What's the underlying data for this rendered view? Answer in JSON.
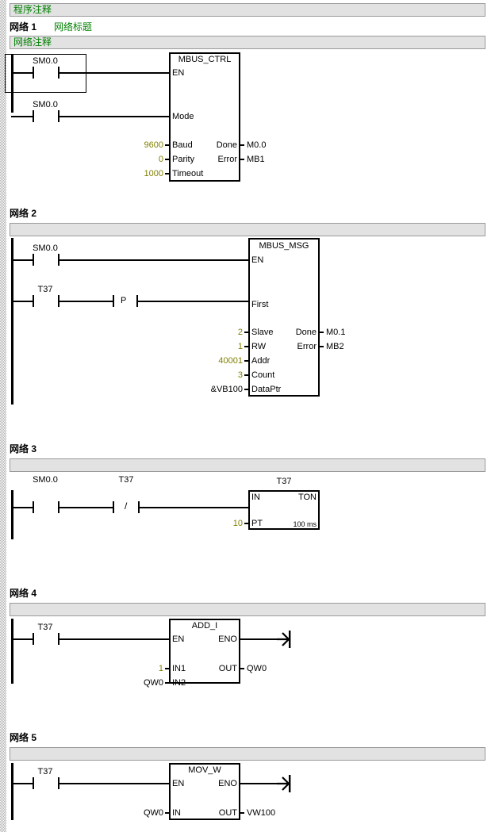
{
  "document": {
    "program_comment": "程序注释",
    "type": "ladder-logic-lad"
  },
  "networks": [
    {
      "label": "网络 1",
      "title": "网络标题",
      "comment": "网络注释",
      "rungs": [
        {
          "contact": "SM0.0",
          "selected": true
        },
        {
          "contact": "SM0.0",
          "selected": false
        }
      ],
      "block": {
        "name": "MBUS_CTRL",
        "inputs": [
          {
            "pin": "EN",
            "value": ""
          },
          {
            "pin": "Mode",
            "value": ""
          },
          {
            "pin": "Baud",
            "value": "9600",
            "const": true
          },
          {
            "pin": "Parity",
            "value": "0",
            "const": true
          },
          {
            "pin": "Timeout",
            "value": "1000",
            "const": true
          }
        ],
        "outputs": [
          {
            "pin": "Done",
            "value": "M0.0"
          },
          {
            "pin": "Error",
            "value": "MB1"
          }
        ]
      }
    },
    {
      "label": "网络 2",
      "title": "",
      "comment": "",
      "rungs": [
        {
          "contact": "SM0.0",
          "selected": false
        },
        {
          "contact": "T37",
          "edge": "P",
          "selected": false
        }
      ],
      "block": {
        "name": "MBUS_MSG",
        "inputs": [
          {
            "pin": "EN",
            "value": ""
          },
          {
            "pin": "First",
            "value": ""
          },
          {
            "pin": "Slave",
            "value": "2",
            "const": true
          },
          {
            "pin": "RW",
            "value": "1",
            "const": true
          },
          {
            "pin": "Addr",
            "value": "40001",
            "const": true
          },
          {
            "pin": "Count",
            "value": "3",
            "const": true
          },
          {
            "pin": "DataPtr",
            "value": "&VB100",
            "const": false
          }
        ],
        "outputs": [
          {
            "pin": "Done",
            "value": "M0.1"
          },
          {
            "pin": "Error",
            "value": "MB2"
          }
        ]
      }
    },
    {
      "label": "网络 3",
      "title": "",
      "comment": "",
      "rungs": [
        {
          "contact": "SM0.0",
          "selected": false
        },
        {
          "contact": "T37",
          "negated": true,
          "selected": false
        }
      ],
      "block": {
        "name": "T37",
        "kind": "TON",
        "inputs": [
          {
            "pin": "IN",
            "value": ""
          },
          {
            "pin": "PT",
            "value": "10",
            "const": true
          }
        ],
        "outputs": [
          {
            "pin": "TON",
            "value": ""
          },
          {
            "pin": "100 ms",
            "value": ""
          }
        ]
      }
    },
    {
      "label": "网络 4",
      "title": "",
      "comment": "",
      "rungs": [
        {
          "contact": "T37",
          "selected": false
        }
      ],
      "block": {
        "name": "ADD_I",
        "inputs": [
          {
            "pin": "EN",
            "value": ""
          },
          {
            "pin": "IN1",
            "value": "1",
            "const": true
          },
          {
            "pin": "IN2",
            "value": "QW0",
            "const": false
          }
        ],
        "outputs": [
          {
            "pin": "ENO",
            "value": ""
          },
          {
            "pin": "OUT",
            "value": "QW0"
          }
        ]
      }
    },
    {
      "label": "网络 5",
      "title": "",
      "comment": "",
      "rungs": [
        {
          "contact": "T37",
          "selected": false
        }
      ],
      "block": {
        "name": "MOV_W",
        "inputs": [
          {
            "pin": "EN",
            "value": ""
          },
          {
            "pin": "IN",
            "value": "QW0",
            "const": false
          }
        ],
        "outputs": [
          {
            "pin": "ENO",
            "value": ""
          },
          {
            "pin": "OUT",
            "value": "VW100"
          }
        ]
      }
    }
  ],
  "colors": {
    "comment_text": "#008000",
    "constant_value": "#808000",
    "bar_fill": "#e2e2e2",
    "bar_border": "#9a9a9a",
    "line": "#000000"
  },
  "net1": {
    "label": "网络 1",
    "title": "网络标题",
    "comment": "网络注释",
    "c1": "SM0.0",
    "c2": "SM0.0",
    "name": "MBUS_CTRL",
    "p_en": "EN",
    "p_mode": "Mode",
    "p_baud": "Baud",
    "p_parity": "Parity",
    "p_timeout": "Timeout",
    "v_baud": "9600",
    "v_parity": "0",
    "v_timeout": "1000",
    "p_done": "Done",
    "p_error": "Error",
    "v_done": "M0.0",
    "v_error": "MB1"
  },
  "net2": {
    "label": "网络 2",
    "c1": "SM0.0",
    "c2": "T37",
    "edge": "P",
    "name": "MBUS_MSG",
    "p_en": "EN",
    "p_first": "First",
    "p_slave": "Slave",
    "p_rw": "RW",
    "p_addr": "Addr",
    "p_count": "Count",
    "p_dataptr": "DataPtr",
    "v_slave": "2",
    "v_rw": "1",
    "v_addr": "40001",
    "v_count": "3",
    "v_dataptr": "&VB100",
    "p_done": "Done",
    "p_error": "Error",
    "v_done": "M0.1",
    "v_error": "MB2"
  },
  "net3": {
    "label": "网络 3",
    "c1": "SM0.0",
    "c2": "T37",
    "neg": "/",
    "name": "T37",
    "p_in": "IN",
    "p_ton": "TON",
    "p_pt": "PT",
    "v_pt": "10",
    "timebase": "100 ms"
  },
  "net4": {
    "label": "网络 4",
    "c1": "T37",
    "name": "ADD_I",
    "p_en": "EN",
    "p_eno": "ENO",
    "p_in1": "IN1",
    "p_in2": "IN2",
    "p_out": "OUT",
    "v_in1": "1",
    "v_in2": "QW0",
    "v_out": "QW0"
  },
  "net5": {
    "label": "网络 5",
    "c1": "T37",
    "name": "MOV_W",
    "p_en": "EN",
    "p_eno": "ENO",
    "p_in": "IN",
    "p_out": "OUT",
    "v_in": "QW0",
    "v_out": "VW100"
  }
}
